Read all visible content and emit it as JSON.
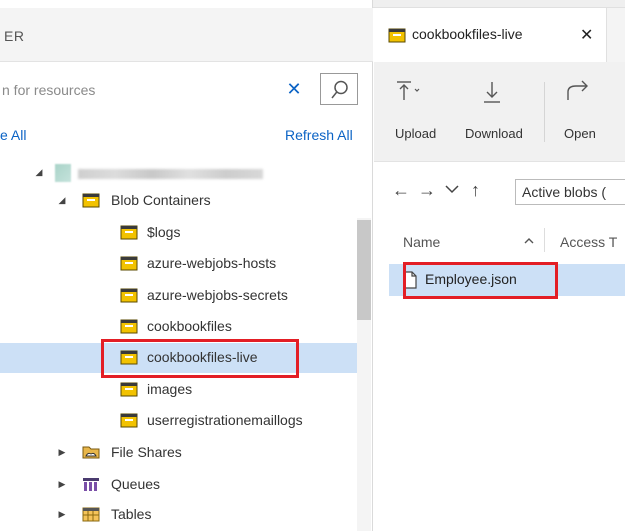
{
  "explorer": {
    "header_title": "ER",
    "search": {
      "placeholder": "n for resources",
      "clear_icon": "close-icon",
      "search_icon": "search-icon"
    },
    "collapse_label": "e All",
    "refresh_label": "Refresh All"
  },
  "tree": {
    "blob_containers": "Blob Containers",
    "containers": [
      "$logs",
      "azure-webjobs-hosts",
      "azure-webjobs-secrets",
      "cookbookfiles",
      "cookbookfiles-live",
      "images",
      "userregistrationemaillogs"
    ],
    "file_shares": "File Shares",
    "queues": "Queues",
    "tables": "Tables",
    "selected": "cookbookfiles-live"
  },
  "tab": {
    "label": "cookbookfiles-live",
    "close_icon": "close-icon"
  },
  "toolbar": {
    "upload": "Upload",
    "download": "Download",
    "open": "Open"
  },
  "nav": {
    "path": "Active blobs (",
    "icons": [
      "back-icon",
      "forward-icon",
      "chevron-down-icon",
      "up-icon"
    ]
  },
  "list": {
    "col_name": "Name",
    "col_access": "Access T",
    "items": [
      "Employee.json"
    ]
  },
  "colors": {
    "accent": "#0b63c5",
    "selection": "#cce0f6",
    "highlight": "#e31e25",
    "container_icon": "#f2c200"
  }
}
